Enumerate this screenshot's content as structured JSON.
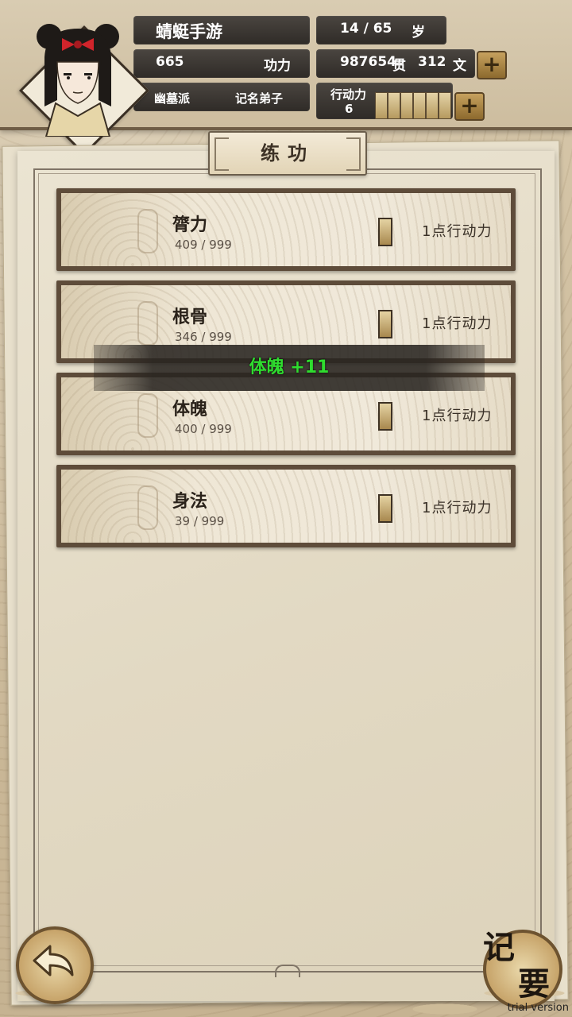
{
  "player": {
    "name": "蜻蜓手游",
    "age": "14 / 65",
    "age_unit": "岁",
    "power_value": "665",
    "power_label": "功力",
    "contribution_value": "987654",
    "contribution_unit": "贯",
    "coins_value": "312",
    "coins_unit": "文",
    "sect": "幽墓派",
    "rank": "记名弟子",
    "action_label": "行动力",
    "action_value": "6",
    "action_segments": 6,
    "add_icon": "plus-icon"
  },
  "panel": {
    "title": "练功"
  },
  "training": [
    {
      "name": "膂力",
      "value": "409 / 999",
      "cost": "1点行动力"
    },
    {
      "name": "根骨",
      "value": "346 / 999",
      "cost": "1点行动力"
    },
    {
      "name": "体魄",
      "value": "400 / 999",
      "cost": "1点行动力"
    },
    {
      "name": "身法",
      "value": "39 / 999",
      "cost": "1点行动力"
    }
  ],
  "toast": {
    "text": "体魄 +11",
    "color": "#2fdc2f"
  },
  "bottom": {
    "back_icon": "back-arrow-icon",
    "memo_char1": "记",
    "memo_char2": "要",
    "watermark": "trial version"
  }
}
